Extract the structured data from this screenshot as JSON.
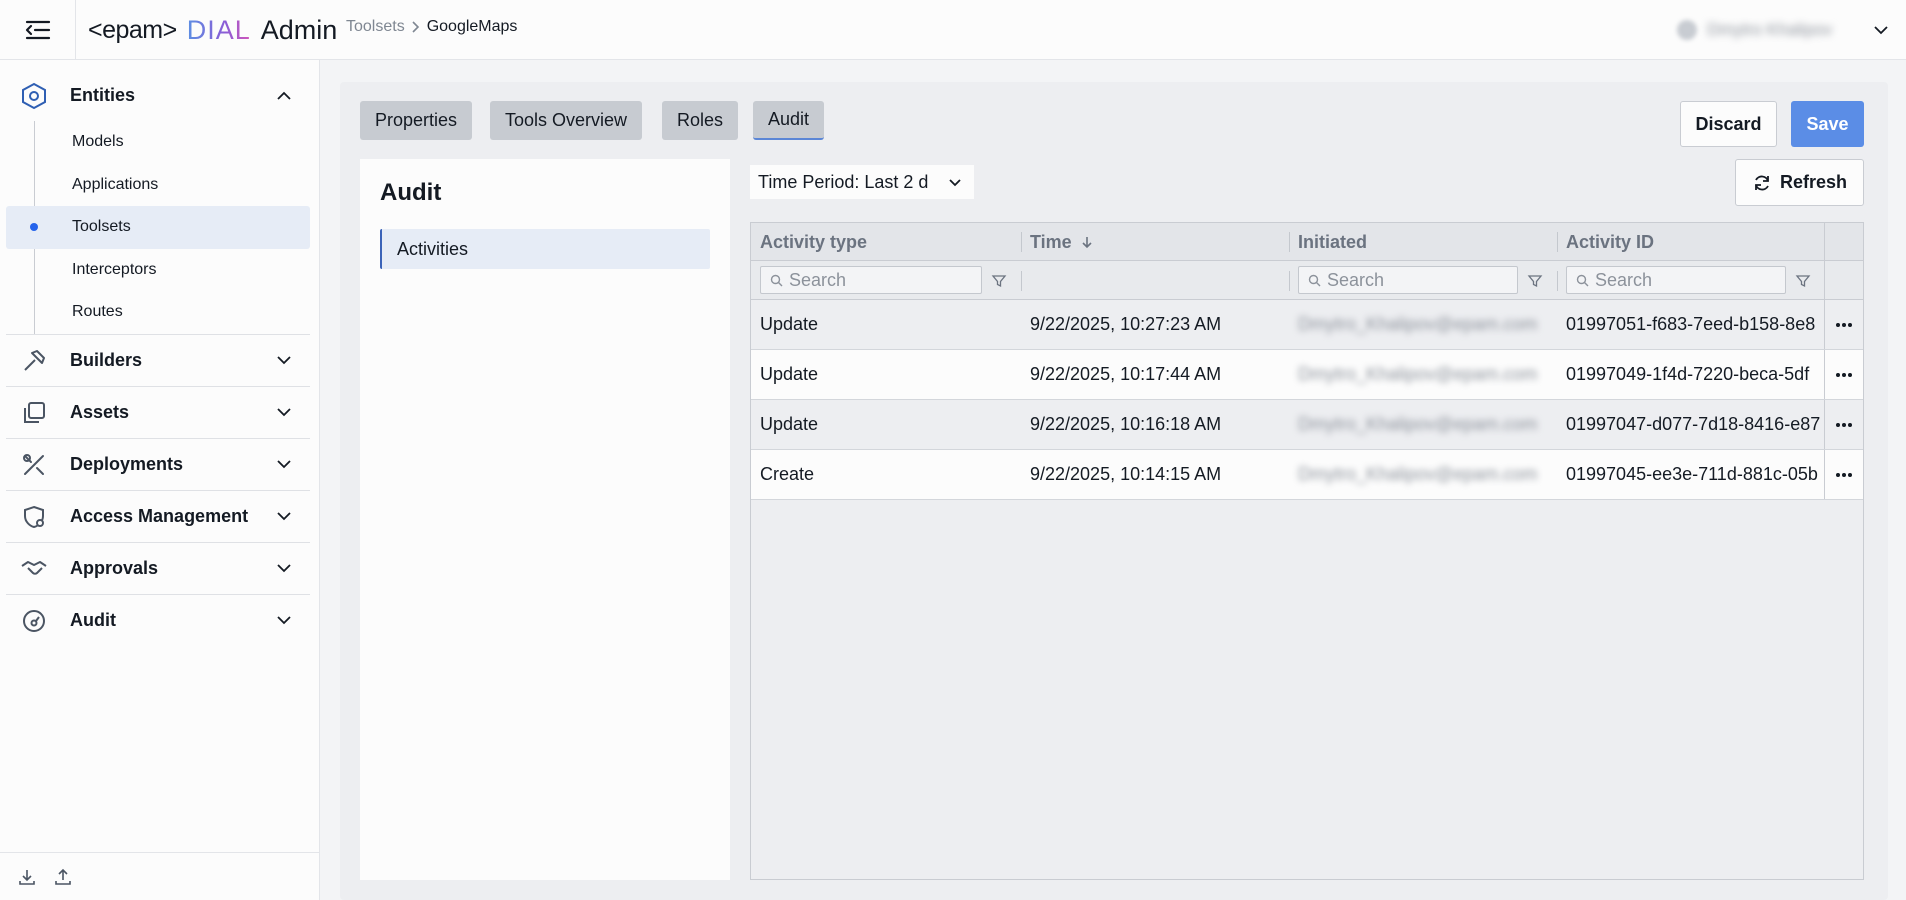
{
  "header": {
    "logo_brand": "<epam>",
    "logo_product": "DIAL",
    "logo_suffix": "Admin",
    "breadcrumb": [
      "Toolsets",
      "GoogleMaps"
    ],
    "user_name": "Dmytro Khalipov"
  },
  "sidebar": {
    "entities": {
      "label": "Entities",
      "items": [
        "Models",
        "Applications",
        "Toolsets",
        "Interceptors",
        "Routes"
      ],
      "active_index": 2
    },
    "groups": [
      "Builders",
      "Assets",
      "Deployments",
      "Access Management",
      "Approvals",
      "Audit"
    ],
    "icons": {
      "entities": "hexagon-icon",
      "builders": "hammer-icon",
      "assets": "stack-icon",
      "deployments": "tools-icon",
      "access_management": "shield-gear-icon",
      "approvals": "handshake-icon",
      "audit": "gauge-icon"
    }
  },
  "tabs": [
    "Properties",
    "Tools Overview",
    "Roles",
    "Audit"
  ],
  "active_tab": "Audit",
  "actions": {
    "discard": "Discard",
    "save": "Save",
    "refresh": "Refresh"
  },
  "audit": {
    "title": "Audit",
    "nav_item": "Activities",
    "time_period": "Time Period: Last 2 d"
  },
  "table": {
    "columns": [
      "Activity type",
      "Time",
      "Initiated",
      "Activity ID"
    ],
    "sort_column": "Time",
    "search_placeholder": "Search",
    "rows": [
      {
        "type": "Update",
        "time": "9/22/2025, 10:27:23 AM",
        "initiated": "Dmytro_Khalipov@epam.com",
        "id": "01997051-f683-7eed-b158-8e8"
      },
      {
        "type": "Update",
        "time": "9/22/2025, 10:17:44 AM",
        "initiated": "Dmytro_Khalipov@epam.com",
        "id": "01997049-1f4d-7220-beca-5df"
      },
      {
        "type": "Update",
        "time": "9/22/2025, 10:16:18 AM",
        "initiated": "Dmytro_Khalipov@epam.com",
        "id": "01997047-d077-7d18-8416-e87"
      },
      {
        "type": "Create",
        "time": "9/22/2025, 10:14:15 AM",
        "initiated": "Dmytro_Khalipov@epam.com",
        "id": "01997045-ee3e-711d-881c-05b"
      }
    ]
  },
  "colors": {
    "accent": "#5b8de6",
    "active_bg": "#e6ecf6",
    "dot": "#2563eb"
  }
}
